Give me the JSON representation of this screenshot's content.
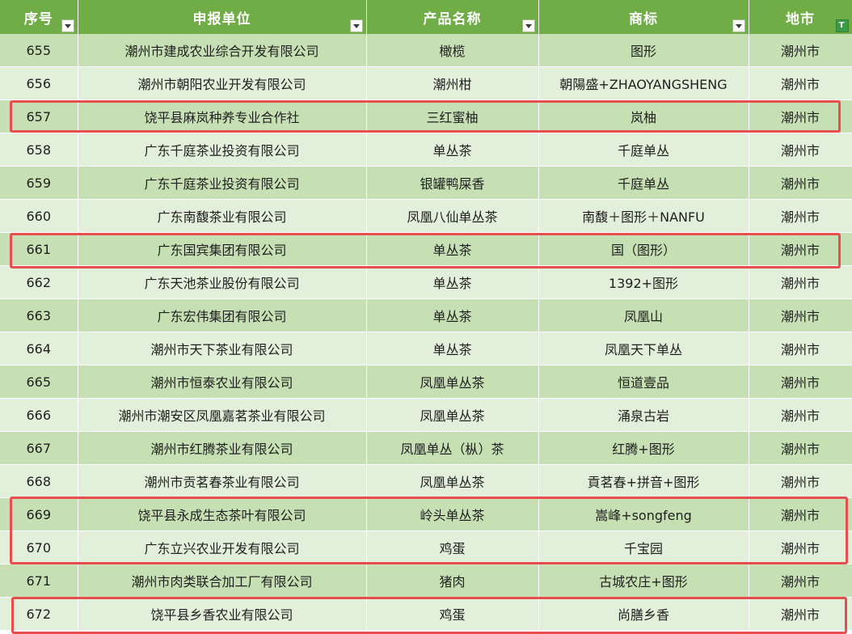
{
  "headers": [
    {
      "label": "序号",
      "filter": "dropdown"
    },
    {
      "label": "申报单位",
      "filter": "dropdown"
    },
    {
      "label": "产品名称",
      "filter": "dropdown"
    },
    {
      "label": "商标",
      "filter": "dropdown"
    },
    {
      "label": "地市",
      "filter": "active"
    }
  ],
  "rows": [
    {
      "no": "655",
      "unit": "潮州市建成农业综合开发有限公司",
      "product": "橄榄",
      "mark": "图形",
      "city": "潮州市"
    },
    {
      "no": "656",
      "unit": "潮州市朝阳农业开发有限公司",
      "product": "潮州柑",
      "mark": "朝陽盛+ZHAOYANGSHENG",
      "city": "潮州市"
    },
    {
      "no": "657",
      "unit": "饶平县麻岚种养专业合作社",
      "product": "三红蜜柚",
      "mark": "岚柚",
      "city": "潮州市"
    },
    {
      "no": "658",
      "unit": "广东千庭茶业投资有限公司",
      "product": "单丛茶",
      "mark": "千庭单丛",
      "city": "潮州市"
    },
    {
      "no": "659",
      "unit": "广东千庭茶业投资有限公司",
      "product": "银罐鸭屎香",
      "mark": "千庭单丛",
      "city": "潮州市"
    },
    {
      "no": "660",
      "unit": "广东南馥茶业有限公司",
      "product": "凤凰八仙单丛茶",
      "mark": "南馥＋图形＋NANFU",
      "city": "潮州市"
    },
    {
      "no": "661",
      "unit": "广东国宾集团有限公司",
      "product": "单丛茶",
      "mark": "国（图形）",
      "city": "潮州市"
    },
    {
      "no": "662",
      "unit": "广东天池茶业股份有限公司",
      "product": "单丛茶",
      "mark": "1392+图形",
      "city": "潮州市"
    },
    {
      "no": "663",
      "unit": "广东宏伟集团有限公司",
      "product": "单丛茶",
      "mark": "凤凰山",
      "city": "潮州市"
    },
    {
      "no": "664",
      "unit": "潮州市天下茶业有限公司",
      "product": "单丛茶",
      "mark": "凤凰天下单丛",
      "city": "潮州市"
    },
    {
      "no": "665",
      "unit": "潮州市恒泰农业有限公司",
      "product": "凤凰单丛茶",
      "mark": "恒道壹品",
      "city": "潮州市"
    },
    {
      "no": "666",
      "unit": "潮州市潮安区凤凰嘉茗茶业有限公司",
      "product": "凤凰单丛茶",
      "mark": "涌泉古岩",
      "city": "潮州市"
    },
    {
      "no": "667",
      "unit": "潮州市红腾茶业有限公司",
      "product": "凤凰单丛（枞）茶",
      "mark": "红腾+图形",
      "city": "潮州市"
    },
    {
      "no": "668",
      "unit": "潮州市贡茗春茶业有限公司",
      "product": "凤凰单丛茶",
      "mark": "貢茗春+拼音+图形",
      "city": "潮州市"
    },
    {
      "no": "669",
      "unit": "饶平县永成生态茶叶有限公司",
      "product": "岭头单丛茶",
      "mark": "嵩峰+songfeng",
      "city": "潮州市"
    },
    {
      "no": "670",
      "unit": "广东立兴农业开发有限公司",
      "product": "鸡蛋",
      "mark": "千宝园",
      "city": "潮州市"
    },
    {
      "no": "671",
      "unit": "潮州市肉类联合加工厂有限公司",
      "product": "猪肉",
      "mark": "古城农庄+图形",
      "city": "潮州市"
    },
    {
      "no": "672",
      "unit": "饶平县乡香农业有限公司",
      "product": "鸡蛋",
      "mark": "尚膳乡香",
      "city": "潮州市"
    }
  ],
  "highlight_color": "#e84e4e"
}
